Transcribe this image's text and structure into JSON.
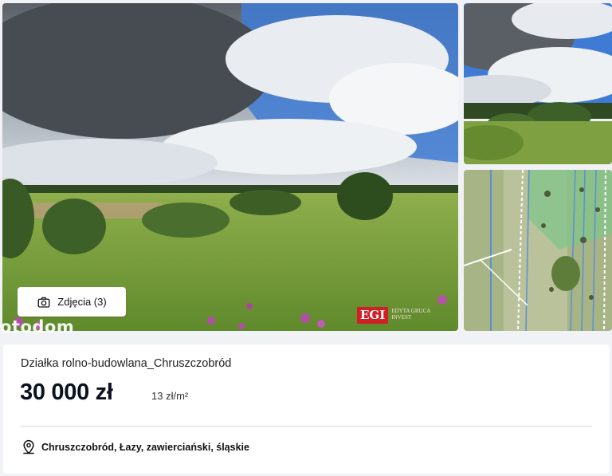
{
  "gallery": {
    "photos_button_label": "Zdjęcia (3)",
    "photos_button_icon": "camera-icon",
    "watermark_text": "otodom",
    "agency_logo_text": "EGI",
    "agency_logo_subtext": "EDYTA GRUCA INVEST",
    "agency_logo_color": "#d21f26"
  },
  "listing": {
    "title": "Działka rolno-budowlana_Chruszczobród",
    "price": "30 000 zł",
    "price_per_m2": "13 zł/m²",
    "location_icon": "map-pin-icon",
    "location": "Chruszczobród, Łazy, zawierciański, śląskie"
  },
  "colors": {
    "page_background": "#f0f2f5",
    "card_background": "#ffffff",
    "price_text": "#0a1220",
    "divider": "#d8dce2"
  }
}
